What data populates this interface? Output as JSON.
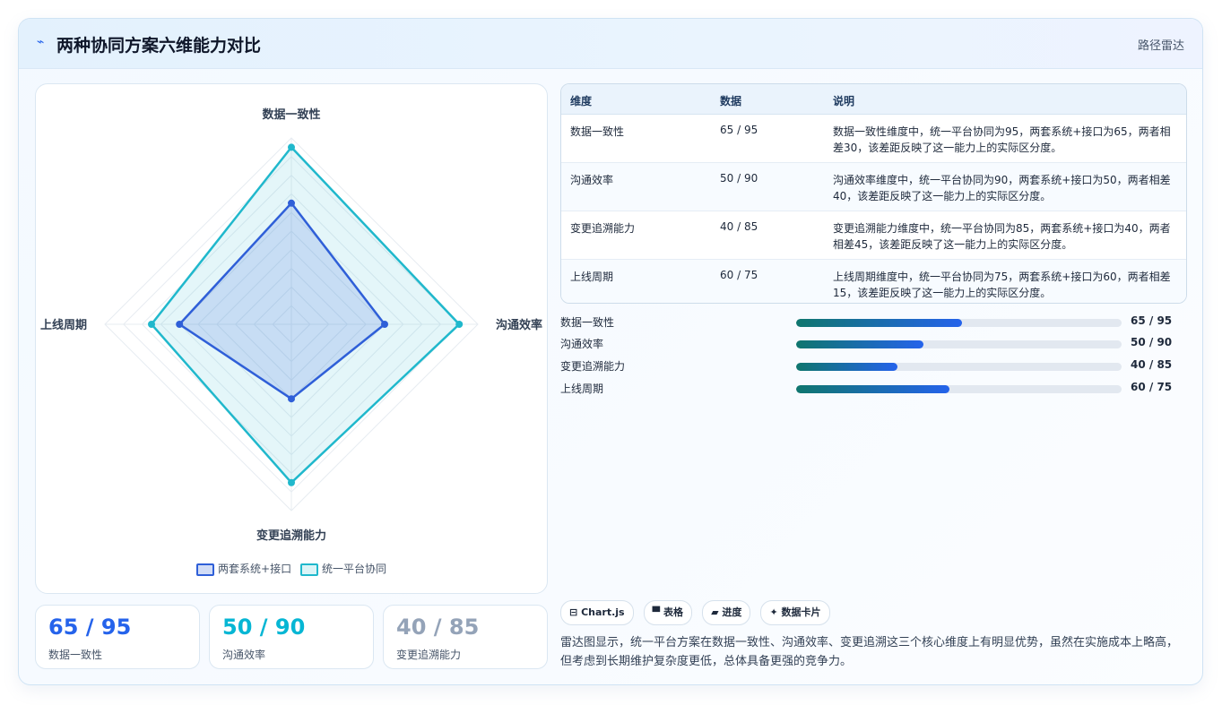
{
  "header": {
    "title": "两种协同方案六维能力对比",
    "tag": "路径雷达",
    "icon": "chart-icon"
  },
  "colors": {
    "seriesA": "#2f5fd8",
    "seriesB": "#20b8cc",
    "accent": "#2563eb"
  },
  "chart_data": {
    "type": "radar",
    "axes": [
      "数据一致性",
      "沟通效率",
      "变更追溯能力",
      "上线周期"
    ],
    "rmax": 100,
    "series": [
      {
        "name": "两套系统+接口",
        "values": [
          65,
          50,
          40,
          60
        ]
      },
      {
        "name": "统一平台协同",
        "values": [
          95,
          90,
          85,
          75
        ]
      }
    ],
    "legend_position": "bottom"
  },
  "stats": [
    {
      "value": "65 / 95",
      "label": "数据一致性",
      "color": "#2563eb"
    },
    {
      "value": "50 / 90",
      "label": "沟通效率",
      "color": "#06b6d4"
    },
    {
      "value": "40 / 85",
      "label": "变更追溯能力",
      "color": "#94a3b8"
    }
  ],
  "table": {
    "headers": [
      "维度",
      "数据",
      "说明"
    ],
    "rows": [
      {
        "dim": "数据一致性",
        "data": "65 / 95",
        "desc": "数据一致性维度中，统一平台协同为95，两套系统+接口为65，两者相差30，该差距反映了这一能力上的实际区分度。"
      },
      {
        "dim": "沟通效率",
        "data": "50 / 90",
        "desc": "沟通效率维度中，统一平台协同为90，两套系统+接口为50，两者相差40，该差距反映了这一能力上的实际区分度。"
      },
      {
        "dim": "变更追溯能力",
        "data": "40 / 85",
        "desc": "变更追溯能力维度中，统一平台协同为85，两套系统+接口为40，两者相差45，该差距反映了这一能力上的实际区分度。"
      },
      {
        "dim": "上线周期",
        "data": "60 / 75",
        "desc": "上线周期维度中，统一平台协同为75，两套系统+接口为60，两者相差15，该差距反映了这一能力上的实际区分度。"
      }
    ]
  },
  "bars": [
    {
      "label": "数据一致性",
      "value": "65 / 95",
      "fill_pct": 51
    },
    {
      "label": "沟通效率",
      "value": "50 / 90",
      "fill_pct": 39
    },
    {
      "label": "变更追溯能力",
      "value": "40 / 85",
      "fill_pct": 31
    },
    {
      "label": "上线周期",
      "value": "60 / 75",
      "fill_pct": 47
    }
  ],
  "chips": [
    {
      "icon": "window-icon",
      "glyph": "⊟",
      "label": "Chart.js"
    },
    {
      "icon": "table-icon",
      "glyph": "▀",
      "label": "表格"
    },
    {
      "icon": "progress-icon",
      "glyph": "▰",
      "label": "进度"
    },
    {
      "icon": "spark-icon",
      "glyph": "✦",
      "label": "数据卡片"
    }
  ],
  "summary": "雷达图显示，统一平台方案在数据一致性、沟通效率、变更追溯这三个核心维度上有明显优势，虽然在实施成本上略高，但考虑到长期维护复杂度更低，总体具备更强的竞争力。"
}
